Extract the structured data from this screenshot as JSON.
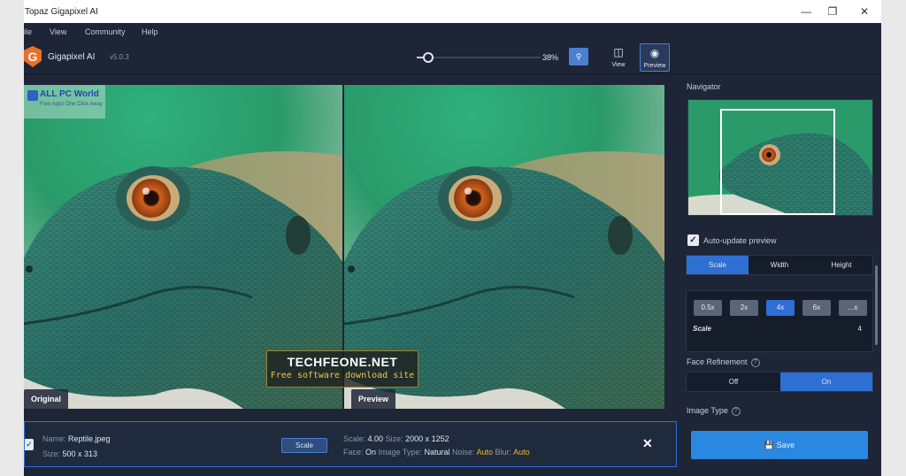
{
  "window": {
    "title": "Topaz Gigapixel AI",
    "controls": [
      "—",
      "❐",
      "✕"
    ]
  },
  "menu": [
    "ile",
    "View",
    "Community",
    "Help"
  ],
  "toolbar": {
    "app_name": "Gigapixel AI",
    "version": "v5.0.3",
    "logo_letter": "G",
    "zoom_percent": "38%",
    "zoom_level": 0.38,
    "view_label": "View",
    "preview_label": "Preview"
  },
  "compare": {
    "left_label": "Original",
    "right_label": "Preview"
  },
  "watermark": {
    "title": "ALL PC World",
    "subtitle": "Free Apps One Click Away"
  },
  "banner": {
    "title": "TECHFEONE.NET",
    "subtitle": "Free software download site"
  },
  "sidebar": {
    "navigator_title": "Navigator",
    "auto_update_label": "Auto-update preview",
    "auto_update_checked": true,
    "resize_modes": [
      "Scale",
      "Width",
      "Height"
    ],
    "resize_mode_selected": "Scale",
    "scale_options": [
      "0.5x",
      "2x",
      "4x",
      "6x",
      "...x"
    ],
    "scale_selected": "4x",
    "scale_label": "Scale",
    "scale_value": "4",
    "face_refinement_title": "Face Refinement",
    "face_options": [
      "Off",
      "On"
    ],
    "face_selected": "On",
    "image_type_title": "Image Type",
    "save_label": "Save"
  },
  "bottombar": {
    "name_label": "Name:",
    "name_value": "Reptile.jpeg",
    "size_label": "Size:",
    "size_value": "500 x 313",
    "scale_button": "Scale",
    "out_scale_label": "Scale:",
    "out_scale_value": "4.00",
    "out_size_label": "Size:",
    "out_size_value": "2000 x 1252",
    "face_label": "Face:",
    "face_value": "On",
    "image_type_label": "Image Type:",
    "image_type_value": "Natural",
    "noise_label": "Noise:",
    "noise_value": "Auto",
    "blur_label": "Blur:",
    "blur_value": "Auto"
  },
  "colors": {
    "accent": "#2e6fd4",
    "panel_bg": "#1d2536",
    "auto_value": "#f2b53a"
  }
}
